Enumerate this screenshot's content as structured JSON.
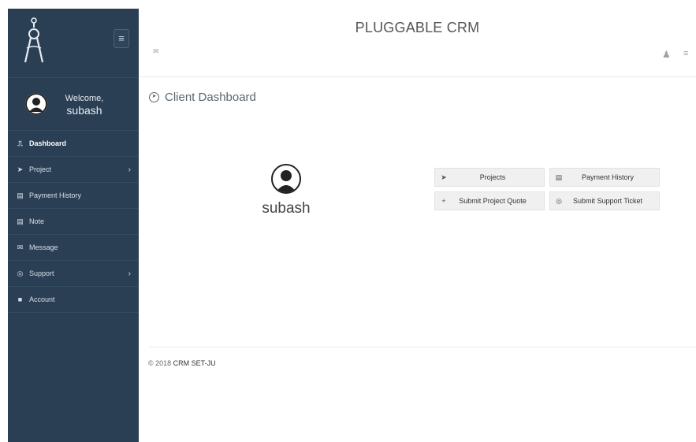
{
  "app": {
    "title": "PLUGGABLE CRM"
  },
  "profile": {
    "welcome": "Welcome,",
    "username": "subash"
  },
  "sidebar": {
    "items": [
      {
        "label": "Dashboard",
        "icon": "dashboard-icon",
        "active": true
      },
      {
        "label": "Project",
        "icon": "paper-plane-icon",
        "has_submenu": true
      },
      {
        "label": "Payment History",
        "icon": "credit-card-icon"
      },
      {
        "label": "Note",
        "icon": "note-icon"
      },
      {
        "label": "Message",
        "icon": "envelope-icon"
      },
      {
        "label": "Support",
        "icon": "life-ring-icon",
        "has_submenu": true
      },
      {
        "label": "Account",
        "icon": "lock-icon"
      }
    ]
  },
  "page": {
    "title": "Client Dashboard"
  },
  "main": {
    "username": "subash"
  },
  "quick_links": [
    {
      "label": "Projects",
      "icon": "paper-plane-icon"
    },
    {
      "label": "Payment History",
      "icon": "credit-card-icon"
    },
    {
      "label": "Submit Project Quote",
      "icon": "plus-icon"
    },
    {
      "label": "Submit Support Ticket",
      "icon": "life-ring-icon"
    }
  ],
  "footer": {
    "copyright": "© 2018",
    "company": "CRM SET-JU"
  },
  "colors": {
    "sidebar_bg": "#2a3f54",
    "button_bg": "#f0f0f0"
  }
}
